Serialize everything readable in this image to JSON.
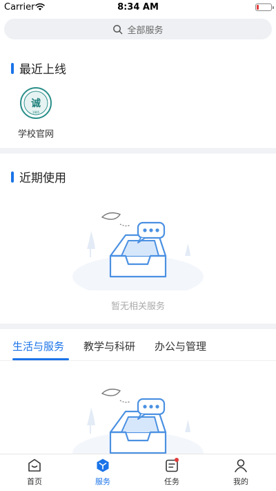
{
  "status_bar": {
    "carrier": "Carrier",
    "time": "8:34 AM"
  },
  "search": {
    "placeholder": "全部服务",
    "icon": "search-icon"
  },
  "recent_online": {
    "title": "最近上线",
    "items": [
      {
        "label": "学校官网",
        "icon": "school-logo"
      }
    ]
  },
  "recent_use": {
    "title": "近期使用",
    "empty_text": "暂无相关服务"
  },
  "tabs": [
    {
      "label": "生活与服务",
      "active": true
    },
    {
      "label": "教学与科研",
      "active": false
    },
    {
      "label": "办公与管理",
      "active": false
    }
  ],
  "bottom_nav": [
    {
      "label": "首页",
      "icon": "home-icon",
      "active": false
    },
    {
      "label": "服务",
      "icon": "services-cube-icon",
      "active": true
    },
    {
      "label": "任务",
      "icon": "tasks-icon",
      "active": false,
      "badge": true
    },
    {
      "label": "我的",
      "icon": "profile-icon",
      "active": false
    }
  ],
  "colors": {
    "accent": "#1a73e8",
    "badge": "#e23b3b",
    "illustration": "#4a90e2"
  }
}
